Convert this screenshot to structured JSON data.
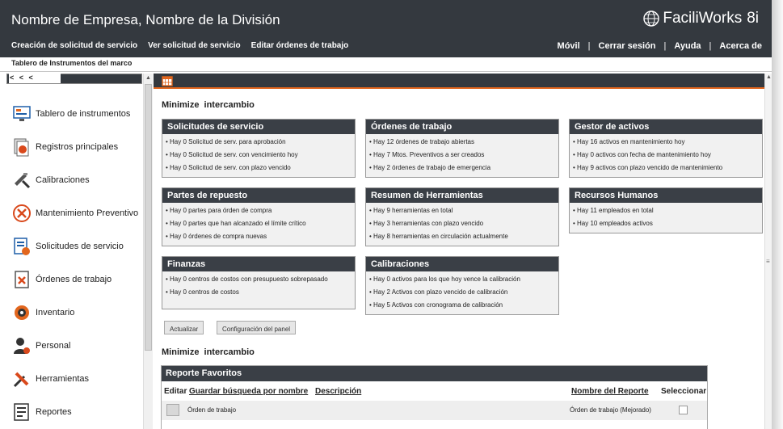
{
  "header": {
    "company": "Nombre de Empresa, Nombre de la División",
    "logo_text": "FaciliWorks",
    "logo_version": "8i",
    "nav_left": [
      "Creación de solicitud de servicio",
      "Ver solicitud de servicio",
      "Editar órdenes de trabajo"
    ],
    "nav_right": [
      "Móvil",
      "Cerrar sesión",
      "Ayuda",
      "Acerca de"
    ]
  },
  "subbar": {
    "label": "Tablero de Instrumentos del marco"
  },
  "sidebar": {
    "collapse_label": "< < <",
    "items": [
      {
        "label": "Tablero de instrumentos",
        "icon": "dashboard-icon"
      },
      {
        "label": "Registros principales",
        "icon": "records-icon"
      },
      {
        "label": "Calibraciones",
        "icon": "calipers-icon"
      },
      {
        "label": "Mantenimiento Preventivo",
        "icon": "maintenance-icon"
      },
      {
        "label": "Solicitudes de servicio",
        "icon": "service-request-icon"
      },
      {
        "label": "Órdenes de trabajo",
        "icon": "work-order-icon"
      },
      {
        "label": "Inventario",
        "icon": "inventory-icon"
      },
      {
        "label": "Personal",
        "icon": "personnel-icon"
      },
      {
        "label": "Herramientas",
        "icon": "tools-icon"
      },
      {
        "label": "Reportes",
        "icon": "reports-icon"
      }
    ]
  },
  "dashboard": {
    "controls_1": {
      "minimize": "Minimize",
      "exchange": "intercambio"
    },
    "widgets": [
      {
        "title": "Solicitudes de servicio",
        "items": [
          "Hay 0 Solicitud de serv. para aprobación",
          "Hay 0 Solicitud de serv. con vencimiento hoy",
          "Hay 0 Solicitud de serv. con plazo vencido"
        ]
      },
      {
        "title": "Órdenes de trabajo",
        "items": [
          "Hay 12 órdenes de trabajo abiertas",
          "Hay 7 Mtos. Preventivos a ser creados",
          "Hay 2 órdenes de trabajo de emergencia"
        ]
      },
      {
        "title": "Gestor de activos",
        "items": [
          "Hay 16 activos en mantenimiento hoy",
          "Hay 0 activos con fecha de mantenimiento hoy",
          "Hay 9 activos con plazo vencido de mantenimiento"
        ]
      },
      {
        "title": "Partes de repuesto",
        "items": [
          "Hay 0 partes para órden de compra",
          "Hay 0 partes que han alcanzado el límite crítico",
          "Hay 0 órdenes de compra nuevas"
        ]
      },
      {
        "title": "Resumen de Herramientas",
        "items": [
          "Hay 9 herramientas en total",
          "Hay 3 herramientas con plazo vencido",
          "Hay 8 herramientas en circulación actualmente"
        ]
      },
      {
        "title": "Recursos Humanos",
        "items": [
          "Hay 11 empleados en total",
          "Hay 10 empleados activos"
        ]
      },
      {
        "title": "Finanzas",
        "items": [
          "Hay 0 centros de costos con presupuesto sobrepasado",
          "Hay 0 centros de costos"
        ]
      },
      {
        "title": "Calibraciones",
        "items": [
          "Hay 0 activos para los que hoy vence la calibración",
          "Hay 2 Activos con plazo vencido de calibración",
          "Hay 5 Activos con cronograma de calibración"
        ]
      }
    ],
    "buttons": {
      "refresh": "Actualizar",
      "panel_config": "Configuración del panel"
    },
    "controls_2": {
      "minimize": "Minimize",
      "exchange": "intercambio"
    }
  },
  "report": {
    "title": "Reporte Favoritos",
    "headers": {
      "edit": "Editar",
      "save_search": "Guardar búsqueda por nombre",
      "description": "Descripción",
      "report_name": "Nombre del Reporte",
      "select": "Seleccionar"
    },
    "rows": [
      {
        "description": "Órden de trabajo",
        "report_name": "Órden de trabajo (Mejorado)"
      }
    ]
  }
}
